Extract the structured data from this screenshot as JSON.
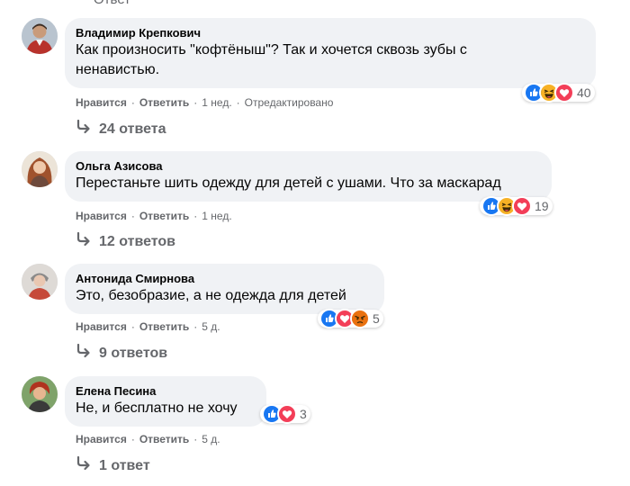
{
  "top_fragment": "Ответ",
  "comments": [
    {
      "author": "Владимир Крепкович",
      "text_lines": [
        "Как произносить \"кофтёныш\"? Так и хочется сквозь зубы с",
        "ненавистью."
      ],
      "reactions": [
        "like",
        "haha",
        "love"
      ],
      "reaction_count": "40",
      "like_label": "Нравится",
      "reply_label": "Ответить",
      "time": "1 нед.",
      "edited": "Отредактировано",
      "replies_label": "24 ответа"
    },
    {
      "author": "Ольга Азисова",
      "text_lines": [
        "Перестаньте шить одежду для детей с ушами. Что за маскарад"
      ],
      "reactions": [
        "like",
        "haha",
        "love"
      ],
      "reaction_count": "19",
      "like_label": "Нравится",
      "reply_label": "Ответить",
      "time": "1 нед.",
      "replies_label": "12 ответов"
    },
    {
      "author": "Антонида Смирнова",
      "text_lines": [
        "Это, безобразие, а не одежда для детей"
      ],
      "reactions": [
        "like",
        "love",
        "angry"
      ],
      "reaction_count": "5",
      "like_label": "Нравится",
      "reply_label": "Ответить",
      "time": "5 д.",
      "replies_label": "9 ответов"
    },
    {
      "author": "Елена Песина",
      "text_lines": [
        "Не, и бесплатно не хочу"
      ],
      "reactions": [
        "like",
        "love"
      ],
      "reaction_count": "3",
      "like_label": "Нравится",
      "reply_label": "Ответить",
      "time": "5 д.",
      "replies_label": "1 ответ"
    }
  ],
  "colors": {
    "bubble": "#f0f2f5",
    "secondary_text": "#65676b",
    "like": "#1877f2",
    "love": "#f33e58",
    "haha": "#f7b125",
    "angry": "#e9710f"
  },
  "icons": {
    "like": "thumbs-up-icon",
    "love": "heart-icon",
    "haha": "laughing-face-icon",
    "angry": "angry-face-icon",
    "reply_arrow": "reply-arrow-icon"
  }
}
